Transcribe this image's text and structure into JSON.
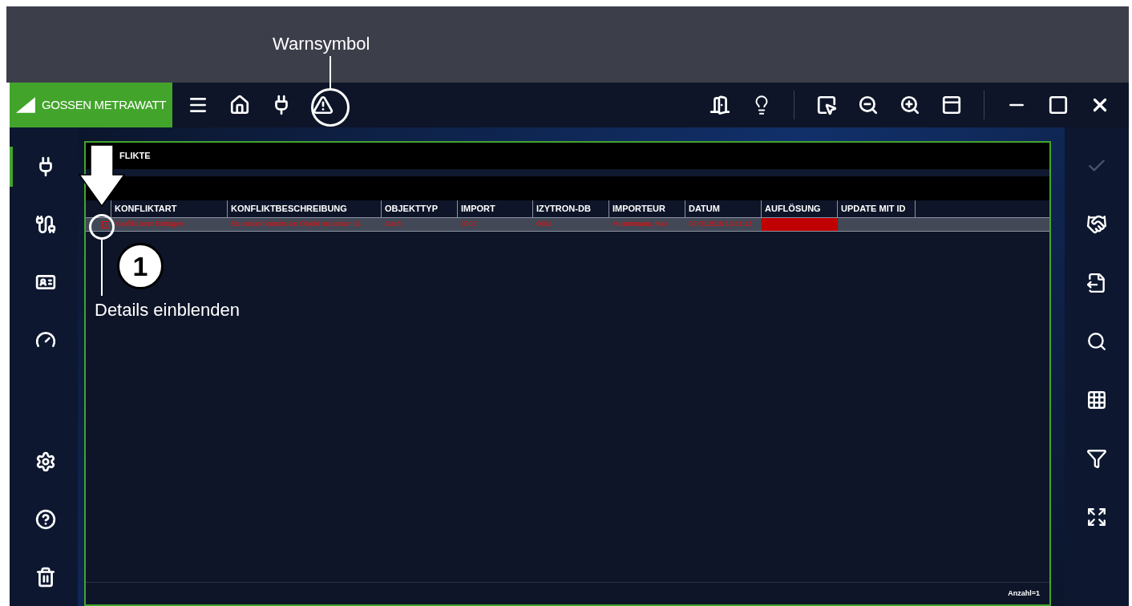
{
  "annotations": {
    "warning_label": "Warnsymbol",
    "step_number": "1",
    "details_label": "Details einblenden"
  },
  "titlebar": {
    "logo": "GOSSEN METRAWATT"
  },
  "sidebar_left": {
    "items": [
      {
        "kind": "plug",
        "selected": true
      },
      {
        "kind": "socket",
        "selected": false
      },
      {
        "kind": "card",
        "selected": false
      },
      {
        "kind": "gauge",
        "selected": false
      },
      {
        "kind": "settings",
        "selected": false
      },
      {
        "kind": "help",
        "selected": false
      },
      {
        "kind": "trash",
        "selected": false
      }
    ]
  },
  "panel": {
    "title": "FLIKTE",
    "columns": [
      "KONFLIKTART",
      "KONFLIKTBESCHREIBUNG",
      "OBJEKTTYP",
      "IMPORT",
      "IZYTRON-DB",
      "IMPORTEUR",
      "DATUM",
      "AUFLÖSUNG",
      "UPDATE MIT ID"
    ],
    "rows": [
      {
        "selected": true,
        "expanded": false,
        "resolved": false,
        "cells": [
          "Konflikt beim Einfügen",
          "Es existiert bereits ein Objekt mit dieser ID.",
          "Gerät",
          "0002",
          "0002",
          "Mustermann, Max",
          "07.05.2018 13:41:13",
          "",
          ""
        ]
      }
    ],
    "footer": "Anzahl=1"
  },
  "sidebar_right": {
    "items": [
      {
        "kind": "check",
        "disabled": true
      },
      {
        "kind": "handshake",
        "disabled": false
      },
      {
        "kind": "export",
        "disabled": false
      },
      {
        "kind": "search",
        "disabled": false
      },
      {
        "kind": "columns",
        "disabled": false
      },
      {
        "kind": "filter",
        "disabled": false
      },
      {
        "kind": "expand",
        "disabled": false
      }
    ]
  }
}
